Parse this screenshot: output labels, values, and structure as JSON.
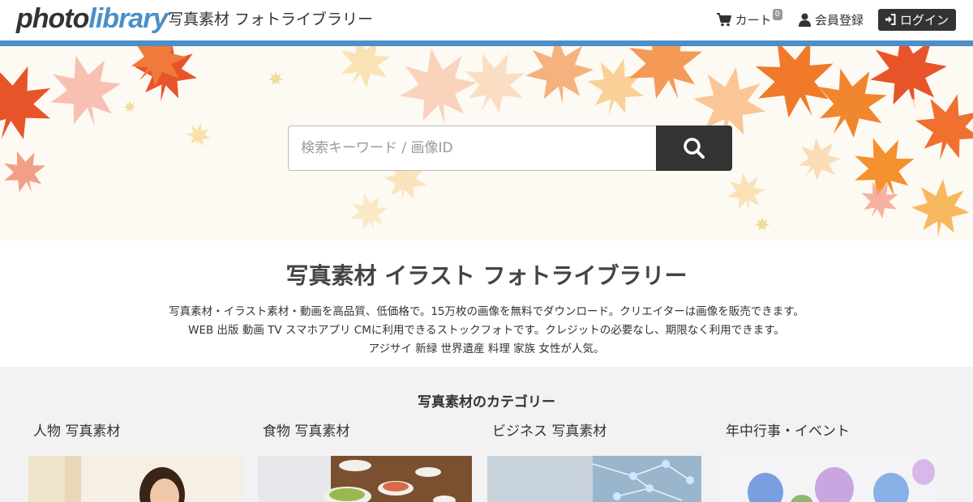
{
  "header": {
    "logo_photo": "photo",
    "logo_library": "library",
    "site_name": "写真素材 フォトライブラリー",
    "cart_label": "カート",
    "cart_count": "0",
    "register_label": "会員登録",
    "login_label": "ログイン"
  },
  "search": {
    "placeholder": "検索キーワード / 画像ID"
  },
  "intro": {
    "title": "写真素材 イラスト フォトライブラリー",
    "line1": "写真素材・イラスト素材・動画を高品質、低価格で。15万枚の画像を無料でダウンロード。クリエイターは画像を販売できます。",
    "line2": "WEB 出版 動画 TV スマホアプリ CMに利用できるストックフォトです。クレジットの必要なし、期限なく利用できます。",
    "line3": "アジサイ 新緑 世界遺産 料理 家族 女性が人気。"
  },
  "categories": {
    "title": "写真素材のカテゴリー",
    "items": [
      {
        "label": "人物 写真素材"
      },
      {
        "label": "食物 写真素材"
      },
      {
        "label": "ビジネス 写真素材"
      },
      {
        "label": "年中行事・イベント"
      }
    ]
  },
  "colors": {
    "brand_blue": "#4a8fc7",
    "dark": "#333333",
    "hero_bg": "#fdf9f3",
    "category_bg": "#f2f2f2"
  },
  "icons": [
    "cart-icon",
    "user-icon",
    "login-icon",
    "search-icon"
  ]
}
